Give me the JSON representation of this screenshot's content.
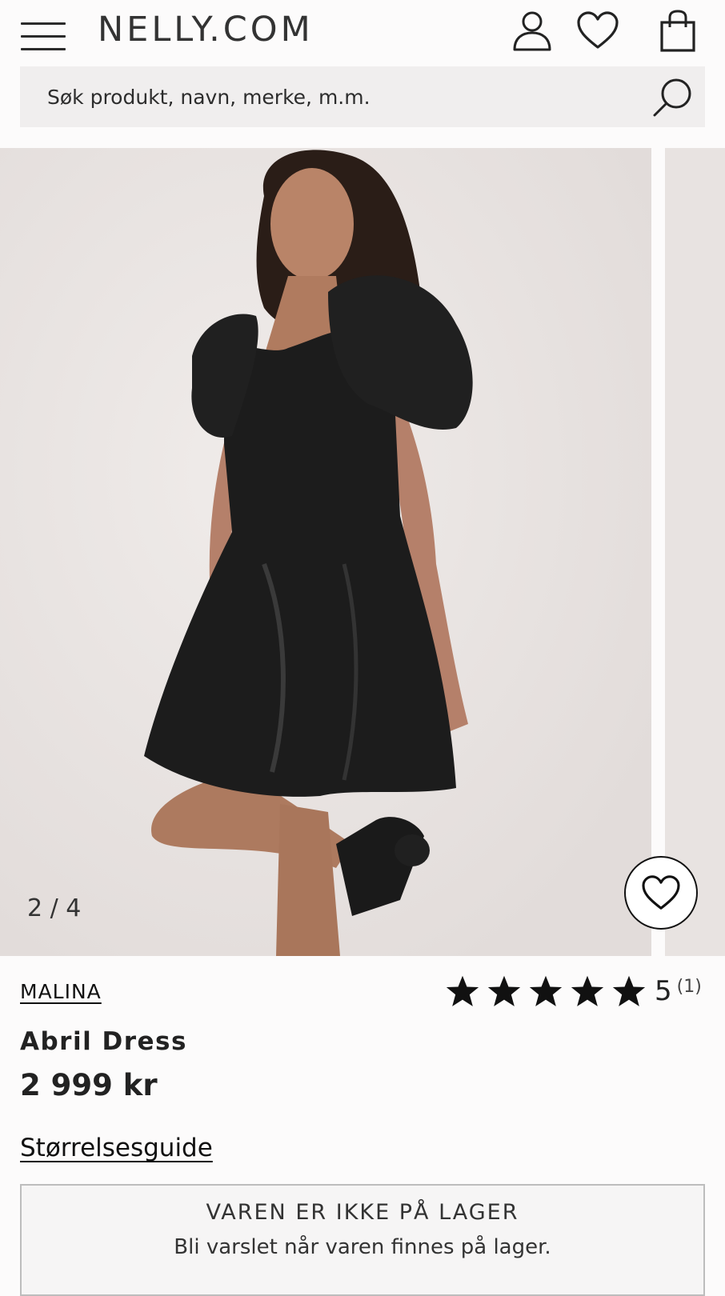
{
  "header": {
    "logo": "NELLY.COM",
    "icons": [
      "menu-icon",
      "account-icon",
      "wishlist-heart-icon",
      "shopping-bag-icon"
    ]
  },
  "search": {
    "placeholder": "Søk produkt, navn, merke, m.m."
  },
  "gallery": {
    "counter": "2 / 4",
    "current_image": 2,
    "total_images": 4
  },
  "product": {
    "brand": "MALINA",
    "name": "Abril Dress",
    "price": "2 999 kr",
    "rating_value": "5",
    "rating_count": "(1)",
    "rating_stars": 5,
    "size_guide_label": "Størrelsesguide"
  },
  "stock": {
    "title": "VAREN ER IKKE PÅ LAGER",
    "subtitle": "Bli varslet når varen finnes på lager."
  },
  "colors": {
    "text": "#222222",
    "search_bg": "#f0eeee",
    "page_bg": "#fcfbfb"
  }
}
